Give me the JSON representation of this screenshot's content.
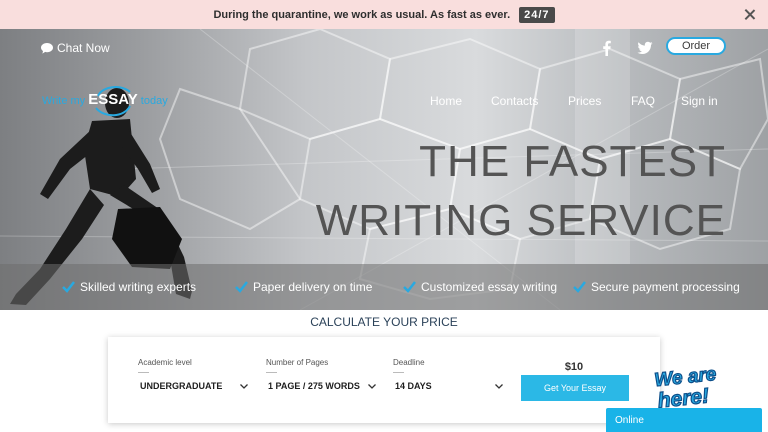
{
  "announcement": {
    "text": "During the quarantine, we work as usual. As fast as ever.",
    "badge": "24/7"
  },
  "header": {
    "chat_label": "Chat Now",
    "order_label": "Order",
    "logo": {
      "prefix": "Write my",
      "main": "ESSAY",
      "suffix": "today"
    },
    "nav": [
      "Home",
      "Contacts",
      "Prices",
      "FAQ",
      "Sign in"
    ]
  },
  "hero": {
    "headline_line1": "THE FASTEST",
    "headline_line2": "WRITING SERVICE",
    "features": [
      "Skilled writing experts",
      "Paper delivery on time",
      "Customized essay writing",
      "Secure payment processing"
    ]
  },
  "calculator": {
    "title": "CALCULATE YOUR PRICE",
    "academic_level": {
      "label": "Academic level",
      "value": "UNDERGRADUATE"
    },
    "pages": {
      "label": "Number of Pages",
      "value": "1 PAGE / 275 WORDS"
    },
    "deadline": {
      "label": "Deadline",
      "value": "14 DAYS"
    },
    "price": "$10",
    "cta": "Get Your Essay"
  },
  "chat_widget": {
    "sticker_text": "We are here!",
    "status": "Online"
  },
  "colors": {
    "accent": "#29a9e0",
    "cta": "#2bb8e6",
    "announce_bg": "#f9dedd",
    "online": "#19b3e8"
  }
}
